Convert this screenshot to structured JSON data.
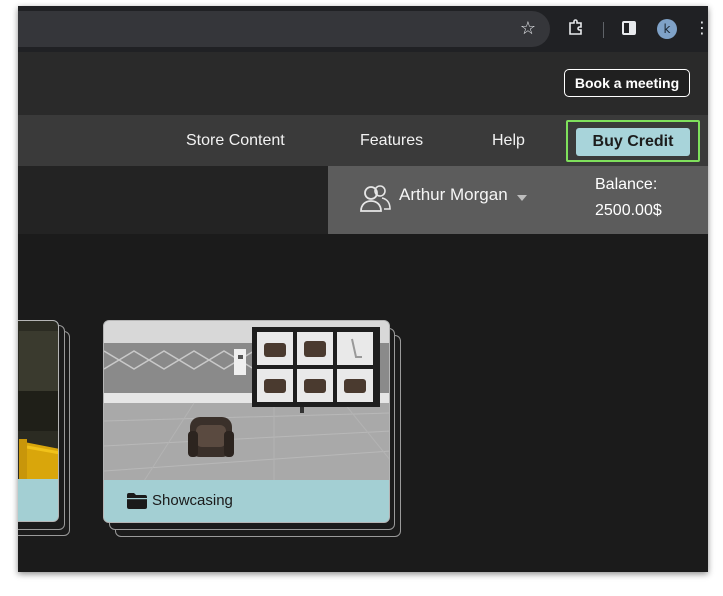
{
  "browser": {
    "avatar_letter": "k",
    "icons": [
      "bookmark-star-icon",
      "extensions-icon",
      "side-panel-icon",
      "profile-avatar",
      "more-menu-icon"
    ]
  },
  "header": {
    "book_meeting_label": "Book a meeting"
  },
  "nav": {
    "items": [
      {
        "label": "Store Content"
      },
      {
        "label": "Features"
      },
      {
        "label": "Help"
      }
    ],
    "buy_credit_label": "Buy Credit",
    "buy_credit_highlight_color": "#7fe05c"
  },
  "user": {
    "name": "Arthur Morgan",
    "balance_label": "Balance:",
    "balance_value": "2500.00$"
  },
  "cards": [
    {
      "label": ""
    },
    {
      "label": "Showcasing",
      "icon": "folder-icon"
    }
  ],
  "colors": {
    "accent": "#a3cfd3",
    "background": "#1b1b1b",
    "nav_bg": "#3a3a3a",
    "user_strip_bg": "#5c5c5c"
  }
}
